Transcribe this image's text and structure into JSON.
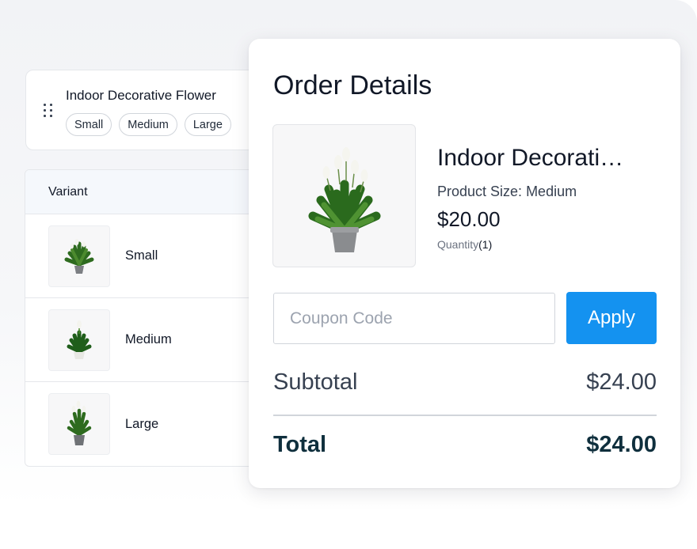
{
  "product_card": {
    "title": "Indoor Decorative Flower",
    "sizes": [
      "Small",
      "Medium",
      "Large"
    ]
  },
  "variants": {
    "header": "Variant",
    "rows": [
      {
        "name": "Small",
        "image": "plant-icon"
      },
      {
        "name": "Medium",
        "image": "plant-icon"
      },
      {
        "name": "Large",
        "image": "plant-icon"
      }
    ]
  },
  "order": {
    "title": "Order Details",
    "product_name": "Indoor Decorati…",
    "size_label": "Product Size: ",
    "size_value": "Medium",
    "price": "$20.00",
    "quantity_label": "Quantity",
    "quantity_value": "(1)",
    "coupon_placeholder": "Coupon Code",
    "coupon_value": "",
    "apply_label": "Apply",
    "subtotal_label": "Subtotal",
    "subtotal_value": "$24.00",
    "total_label": "Total",
    "total_value": "$24.00"
  },
  "colors": {
    "accent": "#1492f0",
    "total_text": "#0f2f3d"
  }
}
